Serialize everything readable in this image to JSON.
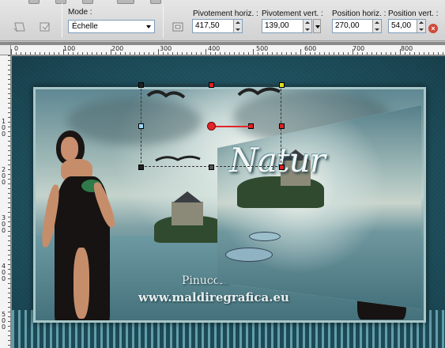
{
  "toolbar": {
    "mode_label": "Mode :",
    "mode_value": "Échelle",
    "pivot_h_label": "Pivotement horiz. :",
    "pivot_h_value": "417,50",
    "pivot_v_label": "Pivotement vert. :",
    "pivot_v_value": "139,00",
    "pos_h_label": "Position horiz. :",
    "pos_h_value": "270,00",
    "pos_v_label": "Position vert. :",
    "pos_v_value": "54,00"
  },
  "ruler": {
    "horizontal": [
      "0",
      "100",
      "200",
      "300",
      "400",
      "500",
      "600",
      "700",
      "800"
    ],
    "vertical": [
      "1\n0\n0",
      "2\n0\n0",
      "3\n0\n0",
      "4\n0\n0",
      "5\n0\n0"
    ]
  },
  "canvas": {
    "title_text": "Natur",
    "watermark_line1": "Pinuccia",
    "watermark_line2": "www.maldiregrafica.eu"
  },
  "colors": {
    "handle_red": "#e1262b",
    "canvas_teal": "#1f5260",
    "toolbar_bg": "#d9d9d9"
  }
}
